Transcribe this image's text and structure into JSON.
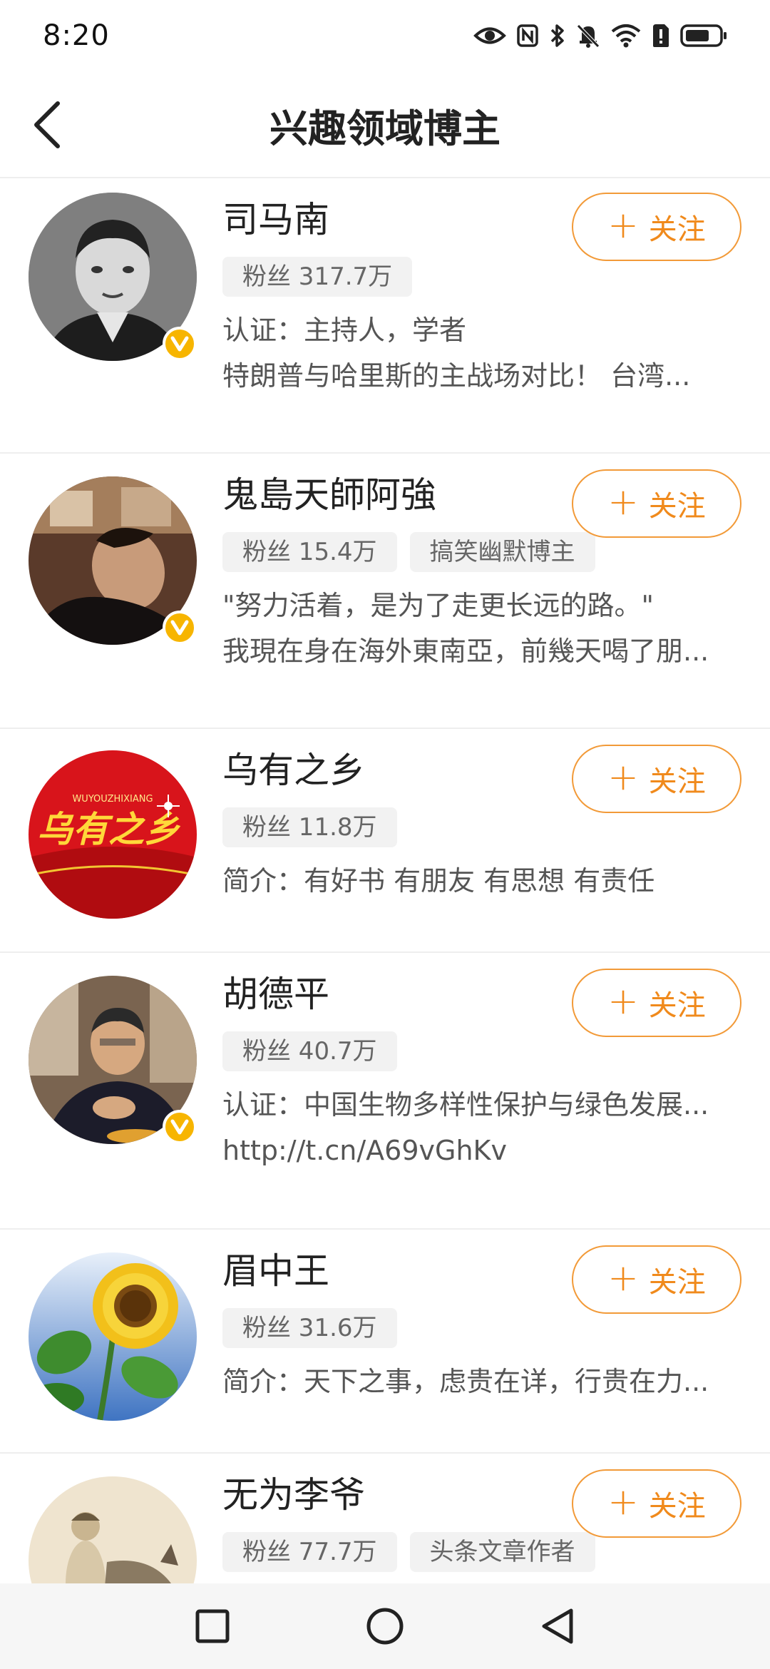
{
  "status_bar": {
    "time": "8:20"
  },
  "nav": {
    "title": "兴趣领域博主",
    "back_icon": "chevron-left-icon"
  },
  "colors": {
    "accent": "#F08A1C",
    "verified": "#F7B500"
  },
  "follow_label": "关注",
  "bloggers": [
    {
      "name": "司马南",
      "verified": true,
      "tags": [
        "粉丝 317.7万"
      ],
      "lines": [
        "认证：主持人，学者",
        "特朗普与哈里斯的主战场对比！ 台湾..."
      ]
    },
    {
      "name": "鬼島天師阿強",
      "verified": true,
      "tags": [
        "粉丝 15.4万",
        "搞笑幽默博主"
      ],
      "lines": [
        "\"努力活着，是为了走更长远的路。\"",
        "我現在身在海外東南亞，前幾天喝了朋..."
      ]
    },
    {
      "name": "乌有之乡",
      "verified": false,
      "tags": [
        "粉丝 11.8万"
      ],
      "lines": [
        "简介：有好书 有朋友 有思想 有责任"
      ]
    },
    {
      "name": "胡德平",
      "verified": true,
      "tags": [
        "粉丝 40.7万"
      ],
      "lines": [
        "认证：中国生物多样性保护与绿色发展...",
        "http://t.cn/A69vGhKv"
      ]
    },
    {
      "name": "眉中王",
      "verified": false,
      "tags": [
        "粉丝 31.6万"
      ],
      "lines": [
        "简介：天下之事，虑贵在详，行贵在力..."
      ]
    },
    {
      "name": "无为李爷",
      "verified": false,
      "tags": [
        "粉丝 77.7万",
        "头条文章作者"
      ],
      "lines": []
    }
  ],
  "avatar_logo_text": "乌有之乡",
  "avatar_logo_pinyin": "WUYOUZHIXIANG"
}
